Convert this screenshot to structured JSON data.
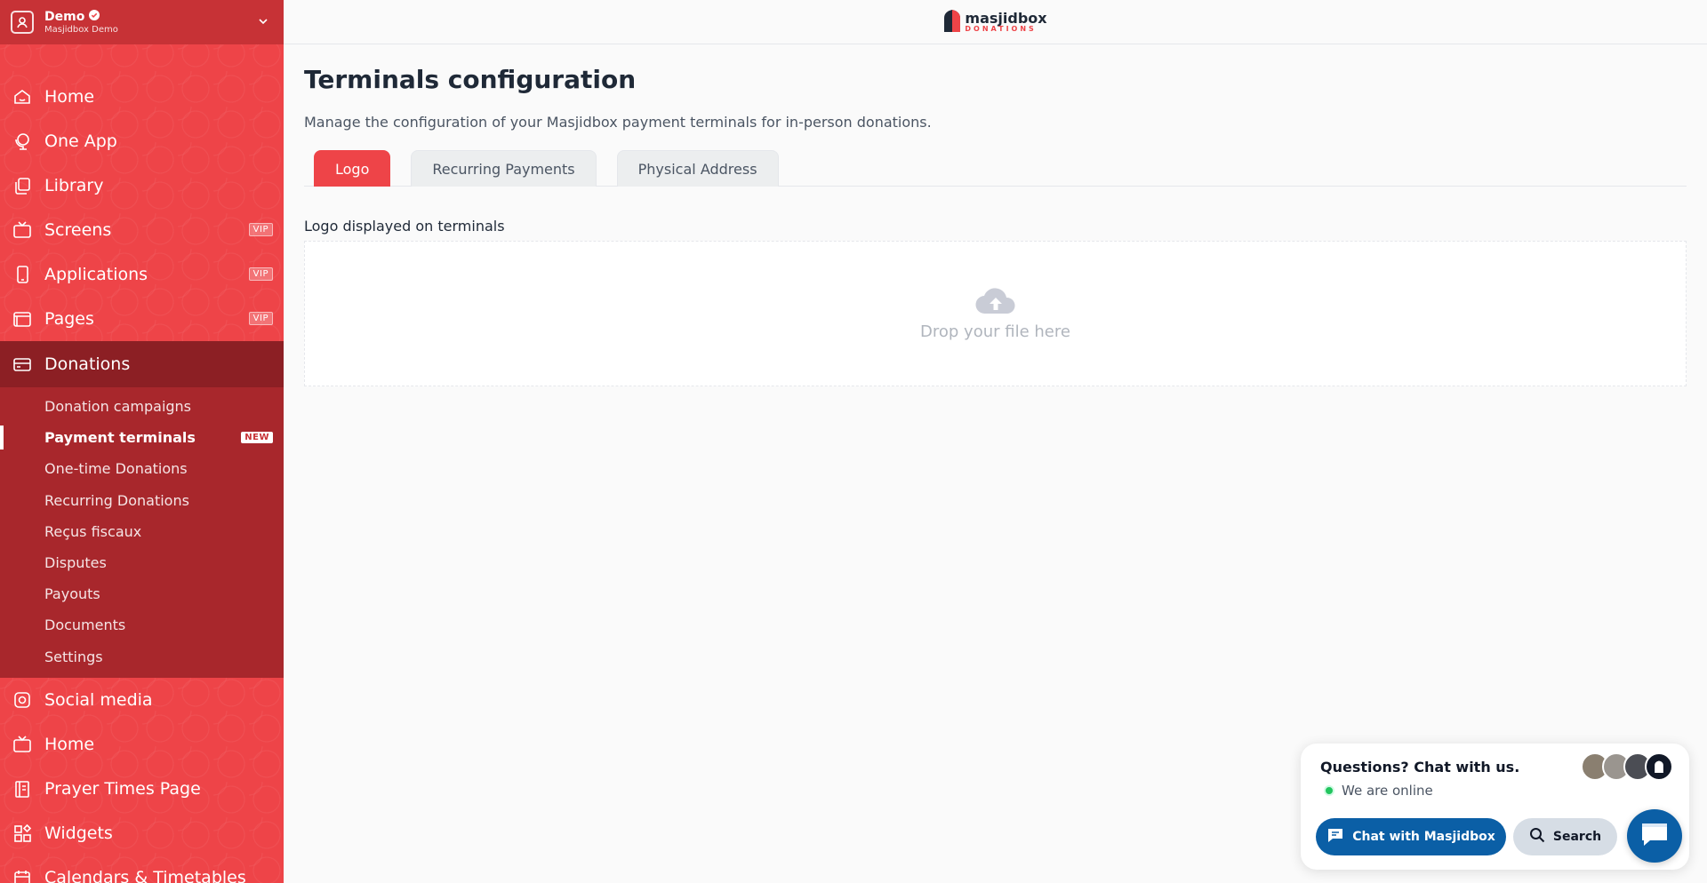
{
  "sidebar": {
    "org_name": "Demo",
    "org_sub": "Masjidbox Demo",
    "items_top": [
      {
        "label": "Home",
        "icon": "home-icon"
      },
      {
        "label": "One App",
        "icon": "globe-icon"
      },
      {
        "label": "Library",
        "icon": "library-icon"
      },
      {
        "label": "Screens",
        "icon": "tv-icon",
        "badge": "VIP"
      },
      {
        "label": "Applications",
        "icon": "phone-icon",
        "badge": "VIP"
      },
      {
        "label": "Pages",
        "icon": "browser-icon",
        "badge": "VIP"
      }
    ],
    "active": {
      "label": "Donations",
      "icon": "card-icon"
    },
    "sub_items": [
      {
        "label": "Donation campaigns"
      },
      {
        "label": "Payment terminals",
        "badge": "NEW"
      },
      {
        "label": "One-time Donations"
      },
      {
        "label": "Recurring Donations"
      },
      {
        "label": "Reçus fiscaux"
      },
      {
        "label": "Disputes"
      },
      {
        "label": "Payouts"
      },
      {
        "label": "Documents"
      },
      {
        "label": "Settings"
      }
    ],
    "items_bottom": [
      {
        "label": "Social media",
        "icon": "instagram-icon"
      },
      {
        "label": "Home",
        "icon": "tv-icon"
      },
      {
        "label": "Prayer Times Page",
        "icon": "book-icon"
      },
      {
        "label": "Widgets",
        "icon": "widgets-icon"
      },
      {
        "label": "Calendars & Timetables",
        "icon": "calendar-icon"
      }
    ]
  },
  "topbar": {
    "logo_main": "masjidbox",
    "logo_sub": "DONATIONS"
  },
  "main": {
    "title": "Terminals configuration",
    "description": "Manage the configuration of your Masjidbox payment terminals for in-person donations.",
    "tabs": [
      {
        "label": "Logo",
        "active": true
      },
      {
        "label": "Recurring Payments",
        "active": false
      },
      {
        "label": "Physical Address",
        "active": false
      }
    ],
    "field_label": "Logo displayed on terminals",
    "dropzone_text": "Drop your file here"
  },
  "chat": {
    "title": "Questions? Chat with us.",
    "status": "We are online",
    "chat_button": "Chat with Masjidbox",
    "search_button": "Search"
  },
  "colors": {
    "brand_red": "#ee4448",
    "dark_red": "#8c1f24",
    "chat_blue": "#0b5fa6"
  }
}
